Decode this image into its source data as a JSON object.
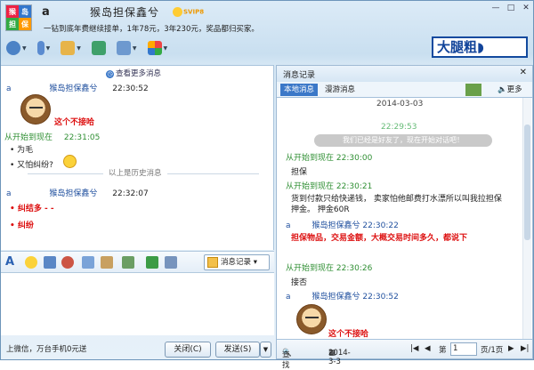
{
  "title": {
    "logo_chars": [
      "猴",
      "岛",
      "担",
      "保"
    ],
    "account": "a",
    "name": "猴岛担保鑫兮",
    "badge": "SVIP8",
    "slogan": "一钻到底年费继续接单，1年78元，3年230元，奖品都归买家。"
  },
  "ad": {
    "text": "大腿粗◗"
  },
  "left": {
    "more_link": "查看更多消息",
    "msg1": {
      "sender": "a",
      "name": "猴岛担保鑫兮",
      "time": "22:30:52",
      "text": "这个不接哈"
    },
    "msg2": {
      "sender": "从开始到现在",
      "time": "22:31:05",
      "lines": [
        "为毛",
        "又怕纠纷?"
      ]
    },
    "history_label": "以上是历史消息",
    "msg3": {
      "sender": "a",
      "name": "猴岛担保鑫兮",
      "time": "22:32:07",
      "lines": [
        "纠结多 - -",
        "纠纷"
      ]
    },
    "history_button": "消息记录",
    "bottom_ad": "上微信，万台手机0元送",
    "close_button": "关闭(C)",
    "send_button": "发送(S)"
  },
  "right": {
    "header": "消息记录",
    "tab_local": "本地消息",
    "tab_roam": "漫游消息",
    "more": "更多",
    "date": "2014-03-03",
    "time_sep": "22:29:53",
    "system": "我们已经是好友了，现在开始对话吧！",
    "m1": {
      "sender": "从开始到现在",
      "time": "22:30:00",
      "text": "担保"
    },
    "m2": {
      "sender": "从开始到现在",
      "time": "22:30:21",
      "text": "货到付款只给快递钱，  卖家怕他邮费打水漂所以叫我拉担保押金。   押金60R"
    },
    "m3": {
      "sender": "a",
      "name": "猴岛担保鑫兮",
      "time": "22:30:22",
      "text": "担保物品，交易金额，大概交易时间多久，都说下"
    },
    "m4": {
      "sender": "从开始到现在",
      "time": "22:30:26",
      "text": "接否"
    },
    "m5": {
      "sender": "a",
      "name": "猴岛担保鑫兮",
      "time": "22:30:52",
      "text": "这个不接哈"
    },
    "search": "查找",
    "date_field": "2014-3-3",
    "page_prefix": "第",
    "page": "1",
    "page_suffix": "页/1页"
  }
}
